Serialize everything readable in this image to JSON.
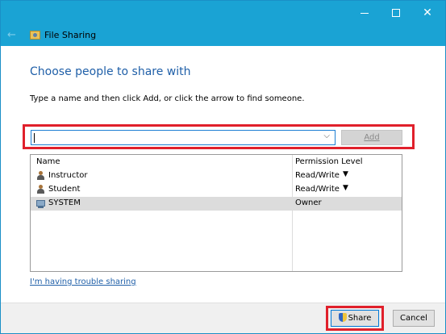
{
  "window": {
    "title": "File Sharing",
    "icons": {
      "back": "back-arrow-icon",
      "app": "file-sharing-icon",
      "minimize": "minimize-icon",
      "maximize": "maximize-icon",
      "close": "close-icon"
    },
    "close_glyph": "✕",
    "back_glyph": "←"
  },
  "main": {
    "heading": "Choose people to share with",
    "instruction": "Type a name and then click Add, or click the arrow to find someone.",
    "name_input": {
      "value": "",
      "placeholder": ""
    },
    "dropdown_glyph": "⌵",
    "add_label": "Add"
  },
  "list": {
    "columns": [
      "Name",
      "Permission Level"
    ],
    "rows": [
      {
        "name": "Instructor",
        "permission": "Read/Write",
        "icon": "user-icon",
        "has_menu": true,
        "selected": false
      },
      {
        "name": "Student",
        "permission": "Read/Write",
        "icon": "user-icon",
        "has_menu": true,
        "selected": false
      },
      {
        "name": "SYSTEM",
        "permission": "Owner",
        "icon": "system-icon",
        "has_menu": false,
        "selected": true
      }
    ],
    "menu_glyph": "▼"
  },
  "trouble_link": "I'm having trouble sharing",
  "footer": {
    "share_label": "Share",
    "cancel_label": "Cancel",
    "highlight_color": "#e0202b",
    "accent_color": "#1aa3d4"
  }
}
